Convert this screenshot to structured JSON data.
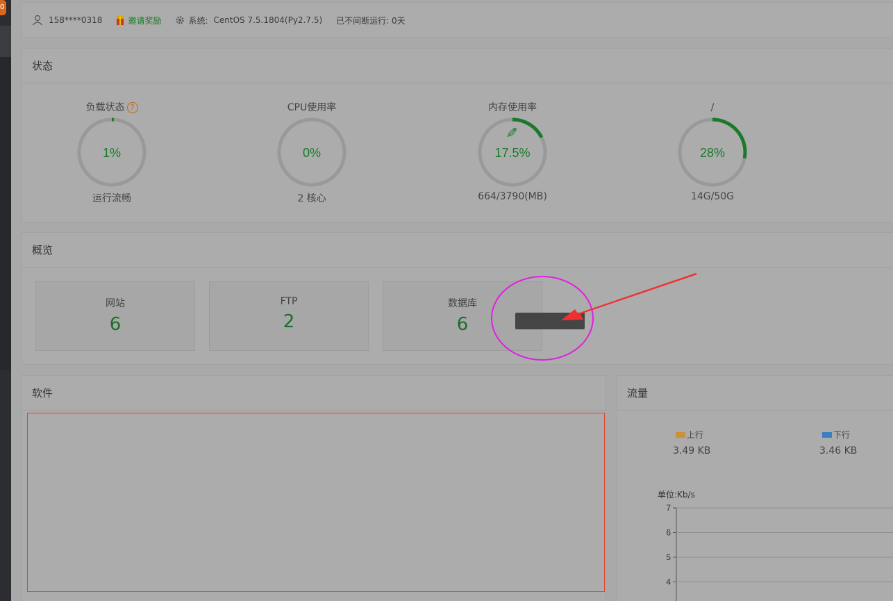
{
  "sidebar": {
    "badge_text": "0"
  },
  "topbar": {
    "user": "158****0318",
    "invite": "邀请奖励",
    "system_label": "系统:",
    "system_value": "CentOS 7.5.1804(Py2.7.5)",
    "uptime": "已不间断运行: 0天"
  },
  "status": {
    "title": "状态",
    "gauges": [
      {
        "title": "负载状态",
        "value": "1%",
        "sub": "运行流畅",
        "percent": 1
      },
      {
        "title": "CPU使用率",
        "value": "0%",
        "sub": "2 核心",
        "percent": 0
      },
      {
        "title": "内存使用率",
        "value": "17.5%",
        "sub": "664/3790(MB)",
        "percent": 17.5
      },
      {
        "title": "/",
        "value": "28%",
        "sub": "14G/50G",
        "percent": 28
      }
    ],
    "help_mark": "?"
  },
  "overview": {
    "title": "概览",
    "cards": [
      {
        "label": "网站",
        "value": "6"
      },
      {
        "label": "FTP",
        "value": "2"
      },
      {
        "label": "数据库",
        "value": "6"
      }
    ]
  },
  "software": {
    "title": "软件"
  },
  "traffic": {
    "title": "流量",
    "up_label": "上行",
    "up_value": "3.49 KB",
    "down_label": "下行",
    "down_value": "3.46 KB",
    "unit": "单位:Kb/s"
  },
  "chart_data": {
    "type": "line",
    "ylabel": "单位:Kb/s",
    "yticks": [
      4,
      5,
      6,
      7
    ],
    "ylim": [
      4,
      7
    ],
    "grid": true,
    "series": []
  },
  "colors": {
    "accent_green": "#1a7a2a",
    "up_color": "#c8913a",
    "down_color": "#3a7fc0",
    "annotation_circle": "#e020e0",
    "annotation_arrow": "#f03030"
  },
  "icons": {
    "user": "user-icon",
    "invite": "gift-icon",
    "system": "gear-icon",
    "memory": "rocket-icon"
  }
}
